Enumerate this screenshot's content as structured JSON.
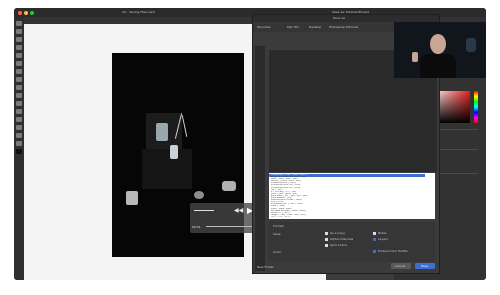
{
  "app": {
    "window_title": "16 – Saving Files.mp4",
    "tab_title": "Save As: Tutorial-HD.psd"
  },
  "dialog": {
    "title": "Save As",
    "path_items": [
      "Favorites",
      "Mac HD",
      "Desktop",
      "Photoshop Tutorials"
    ],
    "search_placeholder": "Search",
    "format_label": "Format:",
    "options_label": "Save:",
    "as_copy": "As a Copy",
    "layers": "Layers",
    "alpha": "Alpha Channels",
    "notes": "Notes",
    "spot": "Spot Colors",
    "color_label": "Color:",
    "embed_profile": "Embed Color Profile",
    "new_folder": "New Folder",
    "cancel": "Cancel",
    "save": "Save",
    "formats": [
      "Photoshop (*.PSD;*.PDD;*.PSDT)",
      "Large Document Format (*.PSB)",
      "BMP (*.BMP;*.RLE;*.DIB)",
      "Dicom (*.DCM;*.DC3;*.DIC)",
      "Photoshop EPS (*.EPS)",
      "Photoshop DCS 1.0 (*.EPS)",
      "Photoshop DCS 2.0 (*.EPS)",
      "GIF (*.GIF)",
      "IFF Format (*.IFF;*.TDI)",
      "JPEG (*.JPG;*.JPEG;*.JPE)",
      "JPEG 2000 (*.JPF;*.JPX;*.JP2;*.J2C)",
      "JPEG Stereo (*.JPS)",
      "Multi-Picture Format (*.MPO)",
      "PCX (*.PCX)",
      "Photoshop PDF (*.PDF;*.PDP)",
      "Pixar (*.PXR)",
      "PNG (*.PNG;*.PNS)",
      "Portable Bit Map (*.PBM;*.PGM)",
      "Scitex CT (*.SCT)",
      "Targa (*.TGA;*.VDA;*.ICB;*.VST)",
      "TIFF (*.TIF;*.TIFF)"
    ]
  },
  "player": {
    "elapsed": "00:51",
    "remaining": "-05:26"
  },
  "colors": {
    "selection": "#3b6fd0",
    "panel_bg": "#3b3b3b"
  }
}
